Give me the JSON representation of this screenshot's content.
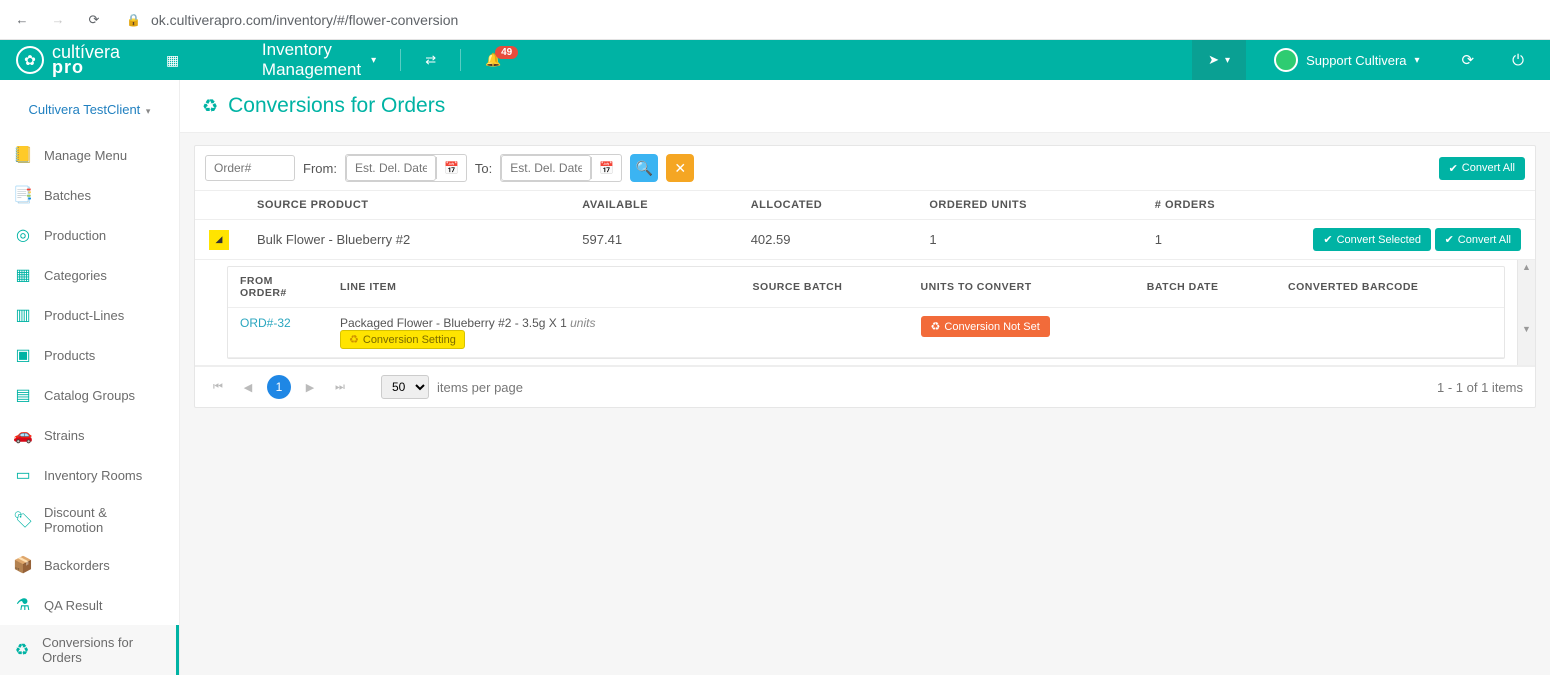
{
  "browser": {
    "url": "ok.cultiverapro.com/inventory/#/flower-conversion"
  },
  "brand": {
    "line1": "cultívera",
    "line2": "pro"
  },
  "module": {
    "label": "Inventory Management"
  },
  "notifications": {
    "count": "49"
  },
  "user": {
    "name": "Support Cultivera"
  },
  "client": {
    "name": "Cultivera TestClient"
  },
  "sidebar": {
    "items": [
      {
        "icon": "📒",
        "label": "Manage Menu"
      },
      {
        "icon": "📑",
        "label": "Batches"
      },
      {
        "icon": "◎",
        "label": "Production"
      },
      {
        "icon": "▦",
        "label": "Categories"
      },
      {
        "icon": "▥",
        "label": "Product-Lines"
      },
      {
        "icon": "▣",
        "label": "Products"
      },
      {
        "icon": "▤",
        "label": "Catalog Groups"
      },
      {
        "icon": "🚗",
        "label": "Strains"
      },
      {
        "icon": "▭",
        "label": "Inventory Rooms"
      },
      {
        "icon": "🏷",
        "label": "Discount & Promotion"
      },
      {
        "icon": "📦",
        "label": "Backorders"
      },
      {
        "icon": "⚗",
        "label": "QA Result"
      },
      {
        "icon": "♻",
        "label": "Conversions for Orders"
      }
    ]
  },
  "page": {
    "title": "Conversions for Orders"
  },
  "filters": {
    "order_placeholder": "Order#",
    "from_label": "From:",
    "to_label": "To:",
    "date_placeholder": "Est. Del. Date",
    "convert_all_label": "Convert All"
  },
  "columns": {
    "source_product": "SOURCE PRODUCT",
    "available": "AVAILABLE",
    "allocated": "ALLOCATED",
    "ordered_units": "ORDERED UNITS",
    "orders_count": "# ORDERS"
  },
  "rows": [
    {
      "source_product": "Bulk Flower - Blueberry #2",
      "available": "597.41",
      "allocated": "402.59",
      "ordered_units": "1",
      "orders_count": "1"
    }
  ],
  "row_actions": {
    "convert_selected": "Convert Selected",
    "convert_all": "Convert All"
  },
  "sub_columns": {
    "from_order": "FROM ORDER#",
    "line_item": "LINE ITEM",
    "source_batch": "SOURCE BATCH",
    "units_to_convert": "UNITS TO CONVERT",
    "batch_date": "BATCH DATE",
    "converted_barcode": "CONVERTED BARCODE"
  },
  "sub_rows": [
    {
      "order_link": "ORD#-32",
      "line_item_text": "Packaged Flower - Blueberry #2 - 3.5g X 1",
      "line_item_units_word": "units",
      "conversion_setting_label": "Conversion Setting",
      "status_label": "Conversion Not Set"
    }
  ],
  "pager": {
    "page": "1",
    "page_size": "50",
    "per_page_label": "items per page",
    "summary": "1 - 1 of 1 items"
  }
}
